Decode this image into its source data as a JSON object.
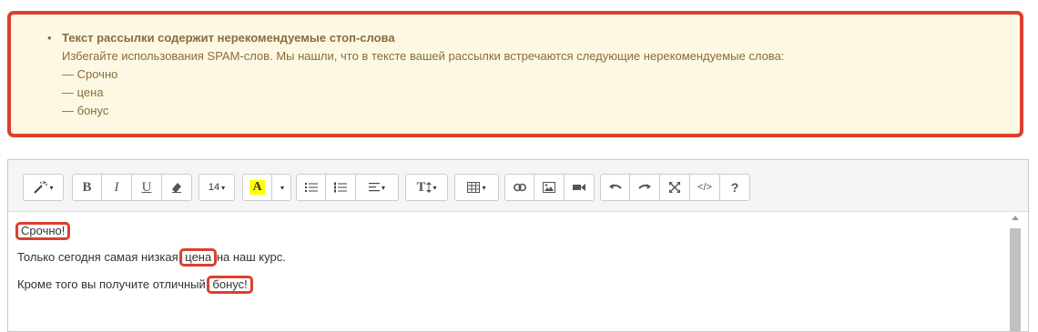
{
  "warning": {
    "title": "Текст рассылки содержит нерекомендуемые стоп-слова",
    "description": "Избегайте использования SPAM-слов. Мы нашли, что в тексте вашей рассылки встречаются следующие нерекомендуемые слова:",
    "words": [
      "— Срочно",
      "— цена",
      "— бонус"
    ],
    "bullet": "•"
  },
  "toolbar": {
    "font_size": "14",
    "highlight_letter": "A",
    "bold": "B",
    "italic": "I",
    "underline": "U",
    "text_size_label": "T",
    "help": "?",
    "code": "</>",
    "caret": "▾"
  },
  "content": {
    "line1": {
      "marked": "Срочно!"
    },
    "line2": {
      "before": "Только сегодня самая низкая ",
      "marked": "цена",
      "after": " на наш курс."
    },
    "line3": {
      "before": "Кроме того вы получите отличный ",
      "marked": "бонус!"
    }
  },
  "colors": {
    "warning_bg": "#fcf8e3",
    "warning_text": "#8a6d3b",
    "highlight_border": "#dc3f2f",
    "highlight_fill": "#ffff00"
  }
}
